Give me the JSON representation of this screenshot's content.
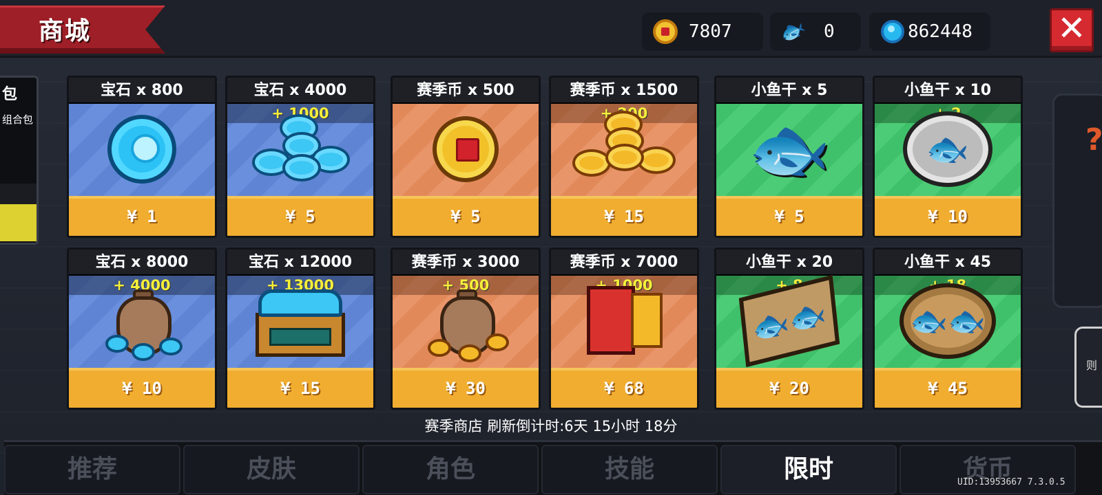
{
  "header": {
    "title": "商城",
    "close_label": "✕",
    "currencies": [
      {
        "name": "season-coin",
        "value": "7807"
      },
      {
        "name": "dried-fish",
        "value": "0"
      },
      {
        "name": "gems",
        "value": "862448"
      }
    ]
  },
  "left_panel": {
    "title": "包",
    "subtitle": "组合包"
  },
  "right_panel": {
    "question": "?",
    "card_text": "则"
  },
  "shop": {
    "items": [
      {
        "title": "宝石 x 800",
        "bonus": "",
        "price": "¥ 1",
        "category": "gem",
        "icon": "gem-coin-icon"
      },
      {
        "title": "宝石 x 4000",
        "bonus": "+ 1000",
        "price": "¥ 5",
        "category": "gem",
        "icon": "gem-pile-icon"
      },
      {
        "title": "赛季币 x 500",
        "bonus": "",
        "price": "¥ 5",
        "category": "season",
        "icon": "season-coin-icon"
      },
      {
        "title": "赛季币 x 1500",
        "bonus": "+ 200",
        "price": "¥ 15",
        "category": "season",
        "icon": "season-coin-pile-icon"
      },
      {
        "title": "小鱼干 x 5",
        "bonus": "",
        "price": "¥ 5",
        "category": "fish",
        "icon": "dried-fish-icon"
      },
      {
        "title": "小鱼干 x 10",
        "bonus": "+ 2",
        "price": "¥ 10",
        "category": "fish",
        "icon": "fish-plate-icon"
      },
      {
        "title": "宝石 x 8000",
        "bonus": "+ 4000",
        "price": "¥ 10",
        "category": "gem",
        "icon": "gem-bag-icon"
      },
      {
        "title": "宝石 x 12000",
        "bonus": "+ 13000",
        "price": "¥ 15",
        "category": "gem",
        "icon": "gem-chest-icon"
      },
      {
        "title": "赛季币 x 3000",
        "bonus": "+ 500",
        "price": "¥ 30",
        "category": "season",
        "icon": "coin-bag-icon"
      },
      {
        "title": "赛季币 x 7000",
        "bonus": "+ 1000",
        "price": "¥ 68",
        "category": "season",
        "icon": "coin-safe-icon"
      },
      {
        "title": "小鱼干 x 20",
        "bonus": "+ 8",
        "price": "¥ 20",
        "category": "fish",
        "icon": "fish-tray-icon"
      },
      {
        "title": "小鱼干 x 45",
        "bonus": "+ 18",
        "price": "¥ 45",
        "category": "fish",
        "icon": "fish-basket-icon"
      }
    ],
    "refresh_text": "赛季商店 刷新倒计时:6天 15小时 18分"
  },
  "tabs": [
    {
      "label": "推荐",
      "active": false
    },
    {
      "label": "皮肤",
      "active": false
    },
    {
      "label": "角色",
      "active": false
    },
    {
      "label": "技能",
      "active": false
    },
    {
      "label": "限时",
      "active": true
    },
    {
      "label": "货币",
      "active": false
    }
  ],
  "uid_text": "UID:13953667 7.3.0.5"
}
